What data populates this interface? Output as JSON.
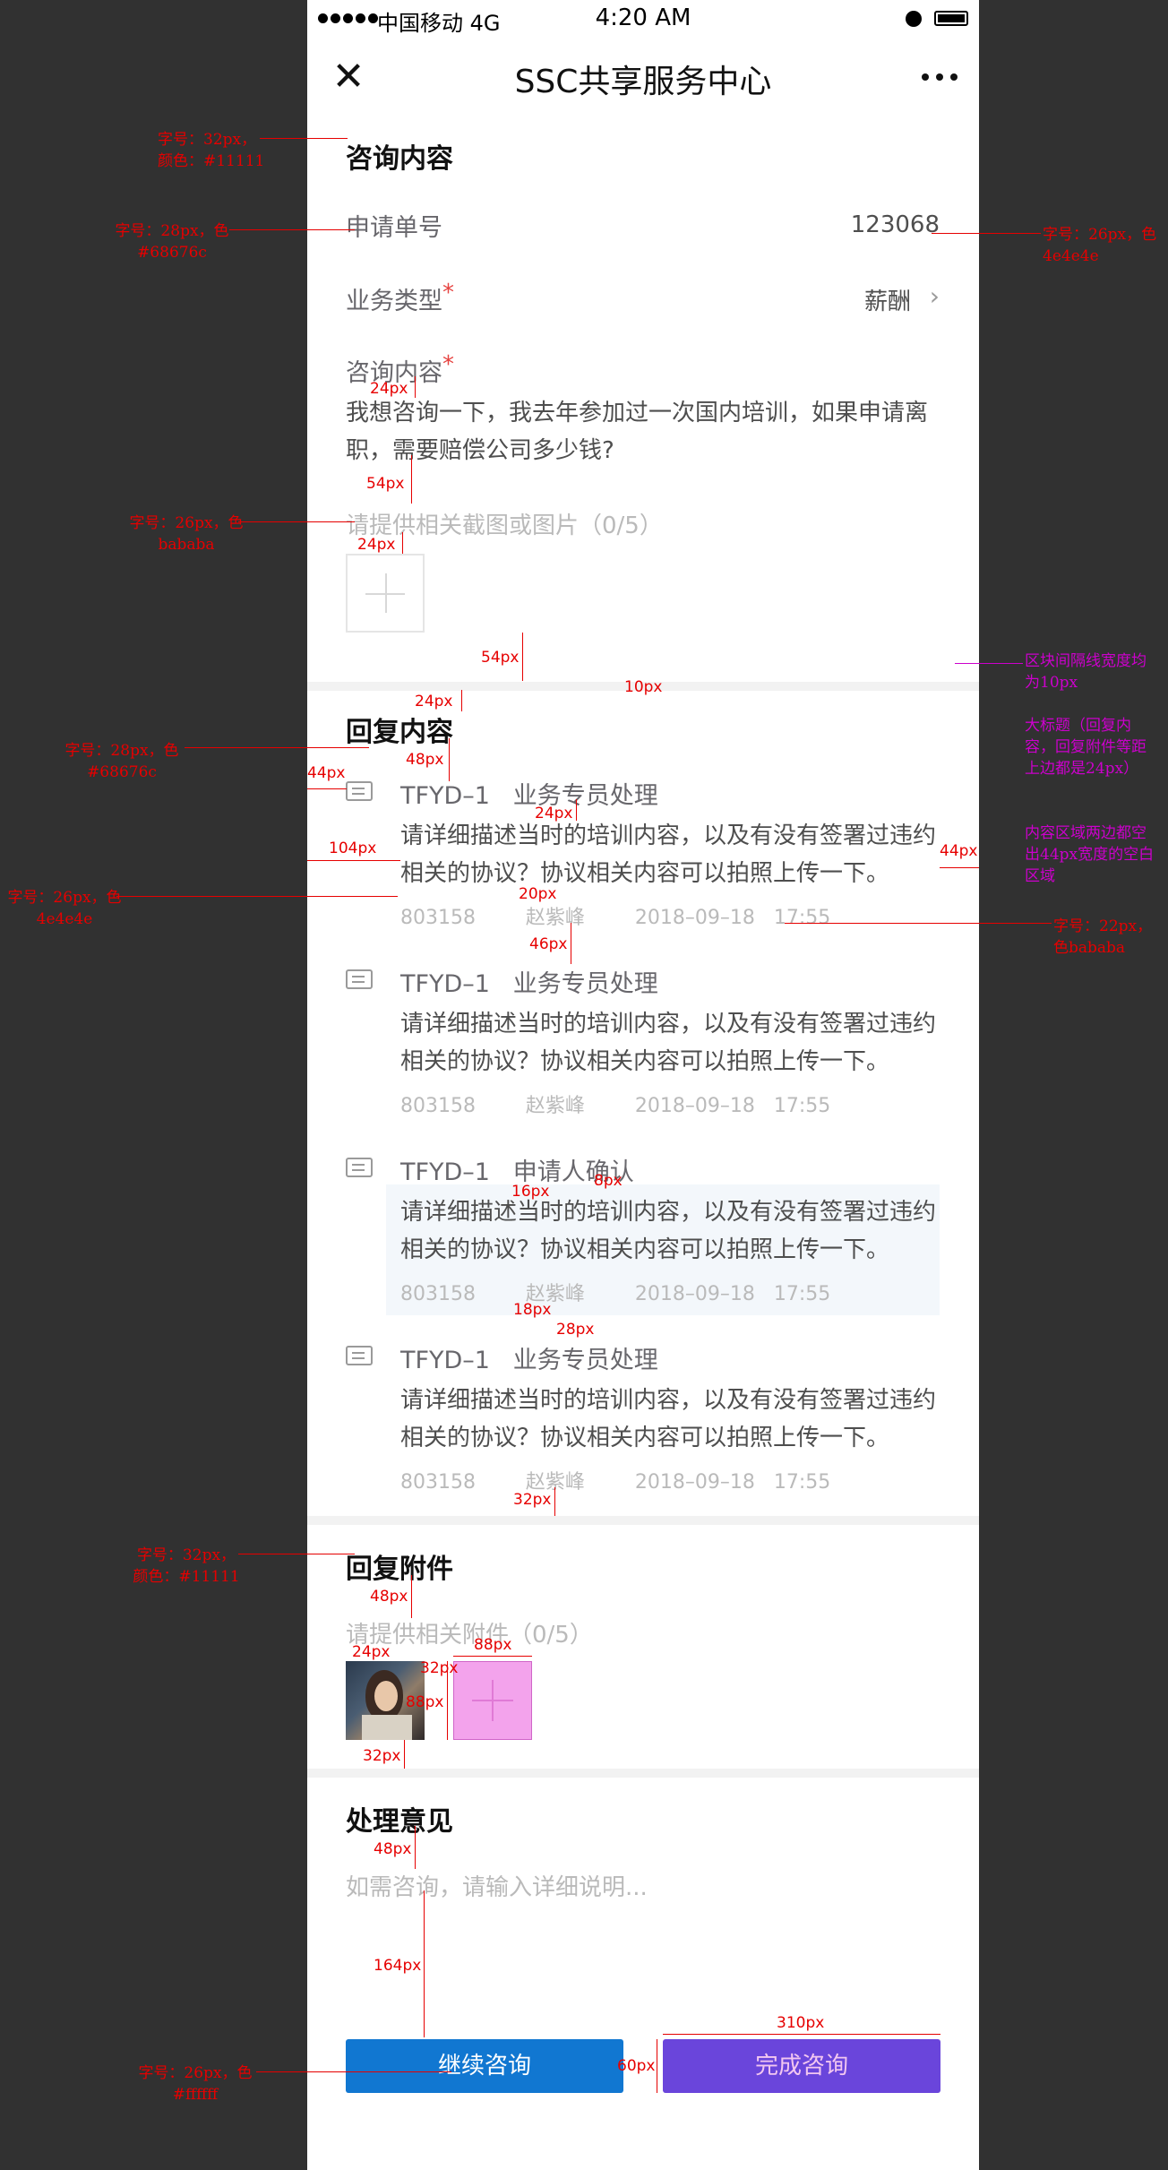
{
  "status_bar": {
    "carrier": "中国移动 4G",
    "time": "4:20 AM"
  },
  "nav": {
    "title": "SSC共享服务中心"
  },
  "consult": {
    "title": "咨询内容",
    "apply_no_label": "申请单号",
    "apply_no_value": "123068",
    "biz_type_label": "业务类型",
    "biz_type_value": "薪酬",
    "required_mark": "*",
    "content_label": "咨询内容",
    "content_text": "我想咨询一下，我去年参加过一次国内培训，如果申请离职，需要赔偿公司多少钱?",
    "image_hint": "请提供相关截图或图片（0/5）"
  },
  "replies_section": {
    "title": "回复内容"
  },
  "replies": [
    {
      "title": "TFYD–1   业务专员处理",
      "content": "请详细描述当时的培训内容，以及有没有签署过违约相关的协议？协议相关内容可以拍照上传一下。",
      "meta": "803158        赵紫峰        2018–09–18   17:55"
    },
    {
      "title": "TFYD–1   业务专员处理",
      "content": "请详细描述当时的培训内容，以及有没有签署过违约相关的协议？协议相关内容可以拍照上传一下。",
      "meta": "803158        赵紫峰        2018–09–18   17:55"
    },
    {
      "title": "TFYD–1   申请人确认",
      "content": "请详细描述当时的培训内容，以及有没有签署过违约相关的协议？协议相关内容可以拍照上传一下。",
      "meta": "803158        赵紫峰        2018–09–18   17:55"
    },
    {
      "title": "TFYD–1   业务专员处理",
      "content": "请详细描述当时的培训内容，以及有没有签署过违约相关的协议？协议相关内容可以拍照上传一下。",
      "meta": "803158        赵紫峰        2018–09–18   17:55"
    }
  ],
  "attachment": {
    "title": "回复附件",
    "hint": "请提供相关附件（0/5）"
  },
  "opinion": {
    "title": "处理意见",
    "placeholder": "如需咨询，请输入详细说明..."
  },
  "buttons": {
    "continue": "继续咨询",
    "finish": "完成咨询",
    "continue_color": "#1177d1",
    "finish_color": "#6a45db"
  },
  "annotations": {
    "a1": "字号：32px，颜色：#11111",
    "a2": "字号：28px，色#68676c",
    "a3": "字号：26px，色4e4e4e",
    "a4": "字号：26px，色bababa",
    "a5": "字号：28px，色#68676c",
    "a6": "字号：26px，色4e4e4e",
    "a7": "字号：22px，色bababa",
    "a8": "字号：32px，颜色：#11111",
    "a9": "字号：26px，色#ffffff",
    "p1": "区块间隔线宽度均为10px",
    "p2": "大标题（回复内容，回复附件等距上边都是24px）",
    "p3": "内容区域两边都空出44px宽度的空白区域"
  },
  "measurements": {
    "m24a": "24px",
    "m54a": "54px",
    "m24b": "24px",
    "m54b": "54px",
    "m10": "10px",
    "m24c": "24px",
    "m48a": "48px",
    "m44a": "44px",
    "m24d": "24px",
    "m104": "104px",
    "m44b": "44px",
    "m20": "20px",
    "m46": "46px",
    "m16": "16px",
    "m8": "8px",
    "m18": "18px",
    "m28": "28px",
    "m32a": "32px",
    "m48b": "48px",
    "m88a": "88px",
    "m24e": "24px",
    "m32b": "32px",
    "m88b": "88px",
    "m32c": "32px",
    "m48c": "48px",
    "m164": "164px",
    "m310": "310px",
    "m60": "60px"
  }
}
